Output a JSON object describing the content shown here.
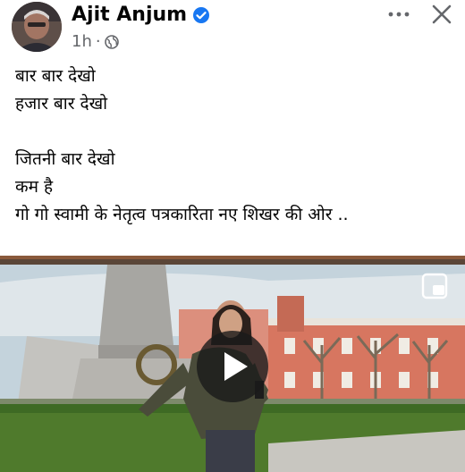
{
  "post": {
    "author": "Ajit Anjum",
    "time": "1h",
    "separator": "·",
    "lines": [
      "बार बार देखो",
      "हजार बार देखो",
      "",
      "जितनी बार देखो",
      "कम है",
      "गो गो स्वामी के नेतृत्व पत्रकारिता नए शिखर की ओर .."
    ]
  },
  "icons": {
    "verified": "verified-badge-icon",
    "audience": "globe-icon",
    "more": "more-options-icon",
    "close": "close-icon",
    "play": "play-icon",
    "pip": "picture-in-picture-icon"
  },
  "colors": {
    "verified_blue": "#1877f2",
    "meta_gray": "#65676b",
    "text": "#050505"
  }
}
